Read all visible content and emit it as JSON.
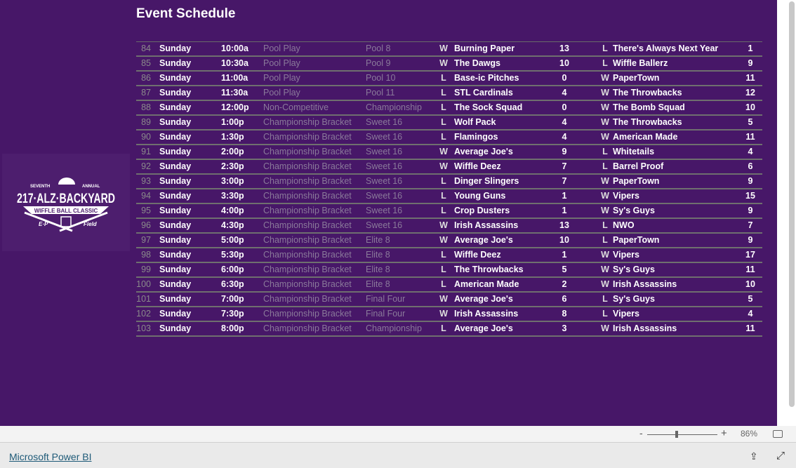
{
  "title": "Event Schedule",
  "logo": {
    "text": "Seventh Annual 217-ALZ-Backyard Wiffle Ball Classic E-P Field"
  },
  "rows": [
    [
      "84",
      "Sunday",
      "10:00a",
      "Pool Play",
      "Pool 8",
      "W",
      "Burning Paper",
      "13",
      "L",
      "There's Always Next Year",
      "1"
    ],
    [
      "85",
      "Sunday",
      "10:30a",
      "Pool Play",
      "Pool 9",
      "W",
      "The Dawgs",
      "10",
      "L",
      "Wiffle Ballerz",
      "9"
    ],
    [
      "86",
      "Sunday",
      "11:00a",
      "Pool Play",
      "Pool 10",
      "L",
      "Base-ic Pitches",
      "0",
      "W",
      "PaperTown",
      "11"
    ],
    [
      "87",
      "Sunday",
      "11:30a",
      "Pool Play",
      "Pool 11",
      "L",
      "STL Cardinals",
      "4",
      "W",
      "The Throwbacks",
      "12"
    ],
    [
      "88",
      "Sunday",
      "12:00p",
      "Non-Competitive",
      "Championship",
      "L",
      "The Sock Squad",
      "0",
      "W",
      "The Bomb Squad",
      "10"
    ],
    [
      "89",
      "Sunday",
      "1:00p",
      "Championship Bracket",
      "Sweet 16",
      "L",
      "Wolf Pack",
      "4",
      "W",
      "The Throwbacks",
      "5"
    ],
    [
      "90",
      "Sunday",
      "1:30p",
      "Championship Bracket",
      "Sweet 16",
      "L",
      "Flamingos",
      "4",
      "W",
      "American Made",
      "11"
    ],
    [
      "91",
      "Sunday",
      "2:00p",
      "Championship Bracket",
      "Sweet 16",
      "W",
      "Average Joe's",
      "9",
      "L",
      "Whitetails",
      "4"
    ],
    [
      "92",
      "Sunday",
      "2:30p",
      "Championship Bracket",
      "Sweet 16",
      "W",
      "Wiffle Deez",
      "7",
      "L",
      "Barrel Proof",
      "6"
    ],
    [
      "93",
      "Sunday",
      "3:00p",
      "Championship Bracket",
      "Sweet 16",
      "L",
      "Dinger Slingers",
      "7",
      "W",
      "PaperTown",
      "9"
    ],
    [
      "94",
      "Sunday",
      "3:30p",
      "Championship Bracket",
      "Sweet 16",
      "L",
      "Young Guns",
      "1",
      "W",
      "Vipers",
      "15"
    ],
    [
      "95",
      "Sunday",
      "4:00p",
      "Championship Bracket",
      "Sweet 16",
      "L",
      "Crop Dusters",
      "1",
      "W",
      "Sy's Guys",
      "9"
    ],
    [
      "96",
      "Sunday",
      "4:30p",
      "Championship Bracket",
      "Sweet 16",
      "W",
      "Irish Assassins",
      "13",
      "L",
      "NWO",
      "7"
    ],
    [
      "97",
      "Sunday",
      "5:00p",
      "Championship Bracket",
      "Elite 8",
      "W",
      "Average Joe's",
      "10",
      "L",
      "PaperTown",
      "9"
    ],
    [
      "98",
      "Sunday",
      "5:30p",
      "Championship Bracket",
      "Elite 8",
      "L",
      "Wiffle Deez",
      "1",
      "W",
      "Vipers",
      "17"
    ],
    [
      "99",
      "Sunday",
      "6:00p",
      "Championship Bracket",
      "Elite 8",
      "L",
      "The Throwbacks",
      "5",
      "W",
      "Sy's Guys",
      "11"
    ],
    [
      "100",
      "Sunday",
      "6:30p",
      "Championship Bracket",
      "Elite 8",
      "L",
      "American Made",
      "2",
      "W",
      "Irish Assassins",
      "10"
    ],
    [
      "101",
      "Sunday",
      "7:00p",
      "Championship Bracket",
      "Final Four",
      "W",
      "Average Joe's",
      "6",
      "L",
      "Sy's Guys",
      "5"
    ],
    [
      "102",
      "Sunday",
      "7:30p",
      "Championship Bracket",
      "Final Four",
      "W",
      "Irish Assassins",
      "8",
      "L",
      "Vipers",
      "4"
    ],
    [
      "103",
      "Sunday",
      "8:00p",
      "Championship Bracket",
      "Championship",
      "L",
      "Average Joe's",
      "3",
      "W",
      "Irish Assassins",
      "11"
    ]
  ],
  "footer": {
    "zoom_minus": "-",
    "zoom_plus": "+",
    "zoom_level": "86%",
    "brand_link": "Microsoft Power BI",
    "share_icon": "share-icon",
    "expand_icon": "expand-icon"
  },
  "colors": {
    "background": "#471768",
    "text": "#ffffff",
    "muted": "#8a7a9a"
  }
}
